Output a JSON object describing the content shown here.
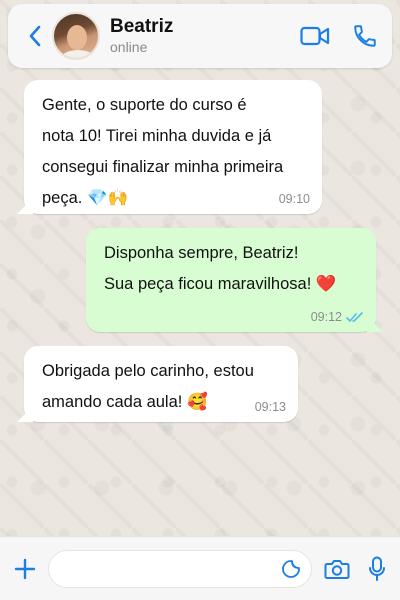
{
  "header": {
    "contact_name": "Beatriz",
    "contact_status": "online",
    "icons": [
      "back-icon",
      "video-call-icon",
      "voice-call-icon"
    ]
  },
  "messages": [
    {
      "direction": "incoming",
      "lines": [
        "Gente, o suporte do curso é",
        "nota 10! Tirei minha duvida e já",
        "consegui finalizar minha primeira",
        "peça. 💎🙌"
      ],
      "time": "09:10"
    },
    {
      "direction": "outgoing",
      "lines": [
        "Disponha sempre, Beatriz!",
        "Sua peça ficou maravilhosa! ❤️"
      ],
      "time": "09:12",
      "status": "read"
    },
    {
      "direction": "incoming",
      "lines": [
        "Obrigada pelo carinho, estou",
        "amando cada aula! 🥰"
      ],
      "time": "09:13"
    }
  ],
  "composer": {
    "value": "",
    "icons": [
      "plus-icon",
      "sticker-icon",
      "camera-icon",
      "microphone-icon"
    ]
  },
  "colors": {
    "accent": "#1a7ee5",
    "incoming_bubble": "#ffffff",
    "outgoing_bubble": "#d9fdd3",
    "read_ticks": "#53bdeb"
  }
}
